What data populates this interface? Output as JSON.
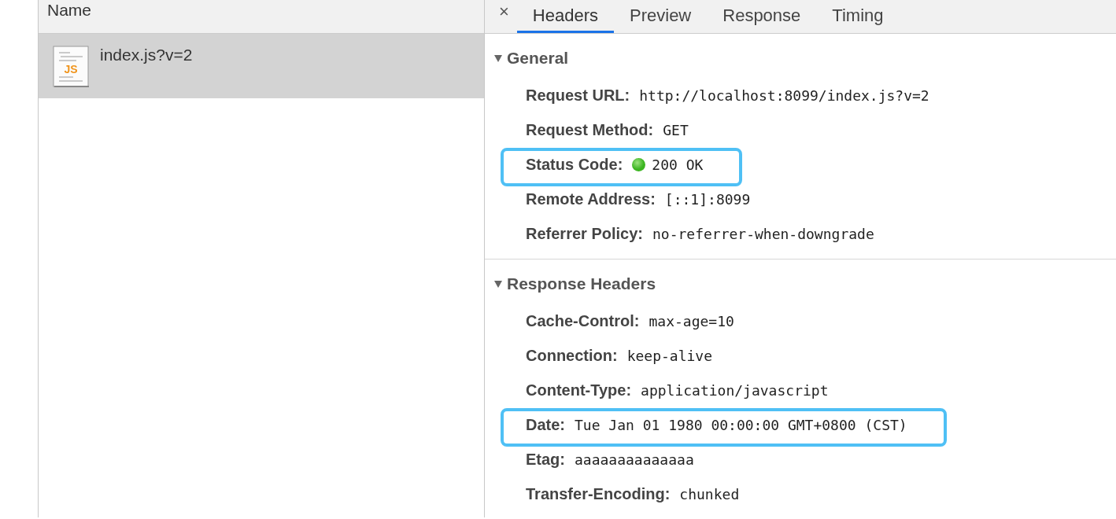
{
  "requests": {
    "column": "Name",
    "items": [
      {
        "name": "index.js?v=2",
        "icon": "JS",
        "selected": true
      }
    ]
  },
  "detail": {
    "close": "×",
    "tabs": [
      {
        "label": "Headers",
        "selected": true
      },
      {
        "label": "Preview",
        "selected": false
      },
      {
        "label": "Response",
        "selected": false
      },
      {
        "label": "Timing",
        "selected": false
      }
    ],
    "sections": [
      {
        "title": "General",
        "expanded": true,
        "rows": [
          {
            "key": "Request URL:",
            "value": "http://localhost:8099/index.js?v=2",
            "highlighted": false
          },
          {
            "key": "Request Method:",
            "value": "GET",
            "highlighted": false
          },
          {
            "key": "Status Code:",
            "value": "200 OK",
            "color": "#3cb521",
            "highlighted": true
          },
          {
            "key": "Remote Address:",
            "value": "[::1]:8099",
            "highlighted": false
          },
          {
            "key": "Referrer Policy:",
            "value": "no-referrer-when-downgrade",
            "highlighted": false
          }
        ]
      },
      {
        "title": "Response Headers",
        "expanded": true,
        "rows": [
          {
            "key": "Cache-Control:",
            "value": "max-age=10",
            "highlighted": false
          },
          {
            "key": "Connection:",
            "value": "keep-alive",
            "highlighted": false
          },
          {
            "key": "Content-Type:",
            "value": "application/javascript",
            "highlighted": false
          },
          {
            "key": "Date:",
            "value": "Tue Jan 01 1980 00:00:00 GMT+0800 (CST)",
            "highlighted": true
          },
          {
            "key": "Etag:",
            "value": "aaaaaaaaaaaaaa",
            "highlighted": false
          },
          {
            "key": "Transfer-Encoding:",
            "value": "chunked",
            "highlighted": false
          }
        ]
      }
    ]
  }
}
